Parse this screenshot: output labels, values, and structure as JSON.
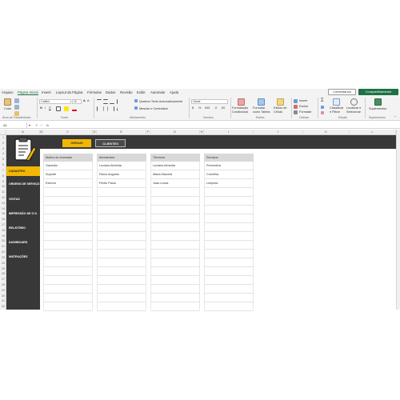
{
  "menu": {
    "tabs": [
      "Arquivo",
      "Página Inicial",
      "Inserir",
      "Layout da Página",
      "Fórmulas",
      "Dados",
      "Revisão",
      "Exibir",
      "Automate",
      "Ajuda"
    ],
    "active_tab": "Página Inicial",
    "comments_label": "Comentários",
    "share_label": "Compartilhamento"
  },
  "ribbon": {
    "clipboard": {
      "paste_label": "Colar",
      "group_label": "Área de Transferência"
    },
    "font": {
      "font_name": "Calibri",
      "font_size": "11",
      "group_label": "Fonte"
    },
    "alignment": {
      "wrap_label": "Quebrar Texto Automaticamente",
      "merge_label": "Mesclar e Centralizar",
      "group_label": "Alinhamento"
    },
    "number": {
      "format": "Geral",
      "group_label": "Número"
    },
    "styles": {
      "conditional_label": "Formatação Condicional",
      "table_label": "Formatar como Tabela",
      "cell_styles_label": "Estilos de Célula",
      "group_label": "Estilos"
    },
    "cells": {
      "insert_label": "Inserir",
      "delete_label": "Excluir",
      "format_label": "Formatar",
      "group_label": "Células"
    },
    "editing": {
      "sort_label": "Classificar e Filtrar",
      "find_label": "Localizar e Selecionar",
      "group_label": "Edição"
    },
    "addins": {
      "label": "Suplementos",
      "group_label": "Suplementos"
    }
  },
  "formula_bar": {
    "cell_ref": "A1",
    "fx": "fx",
    "value": ""
  },
  "columns": [
    "A",
    "B",
    "C",
    "D",
    "E",
    "F",
    "G",
    "H",
    "I",
    "J",
    "K",
    "L"
  ],
  "rows": [
    "1",
    "2",
    "3",
    "4",
    "5",
    "6",
    "7",
    "8",
    "9",
    "10",
    "11",
    "12",
    "13",
    "14",
    "15",
    "16",
    "17",
    "18",
    "19",
    "20",
    "21",
    "22",
    "23",
    "24",
    "25",
    "26",
    "27",
    "28",
    "29",
    "30",
    "31",
    "32"
  ],
  "top_buttons": {
    "gerais": "GERAIS",
    "clientes": "CLIENTES"
  },
  "sidebar": {
    "items": [
      "CADASTRO",
      "ORDENS DE SERVIÇO",
      "VISITAS",
      "IMPRESSÃO DE O.S.",
      "RELATÓRIO",
      "DASHBOARD",
      "INSTRUÇÕES"
    ],
    "active": "CADASTRO"
  },
  "lists": [
    {
      "header": "Motivo do chamado",
      "items": [
        "Garantia",
        "Suporte",
        "Externo"
      ]
    },
    {
      "header": "Atendentes",
      "items": [
        "Luciana Almeida",
        "Flavio Augusto",
        "Pedro Paulo"
      ]
    },
    {
      "header": "Técnicos",
      "items": [
        "Luciana Almeida",
        "Maria Marcela",
        "Joao Lucas"
      ]
    },
    {
      "header": "Serviços",
      "items": [
        "Preventiva",
        "Corretiva",
        "Limpeza"
      ]
    }
  ],
  "colors": {
    "dark": "#383838",
    "accent": "#f2b705",
    "excel_green": "#1e7145"
  }
}
